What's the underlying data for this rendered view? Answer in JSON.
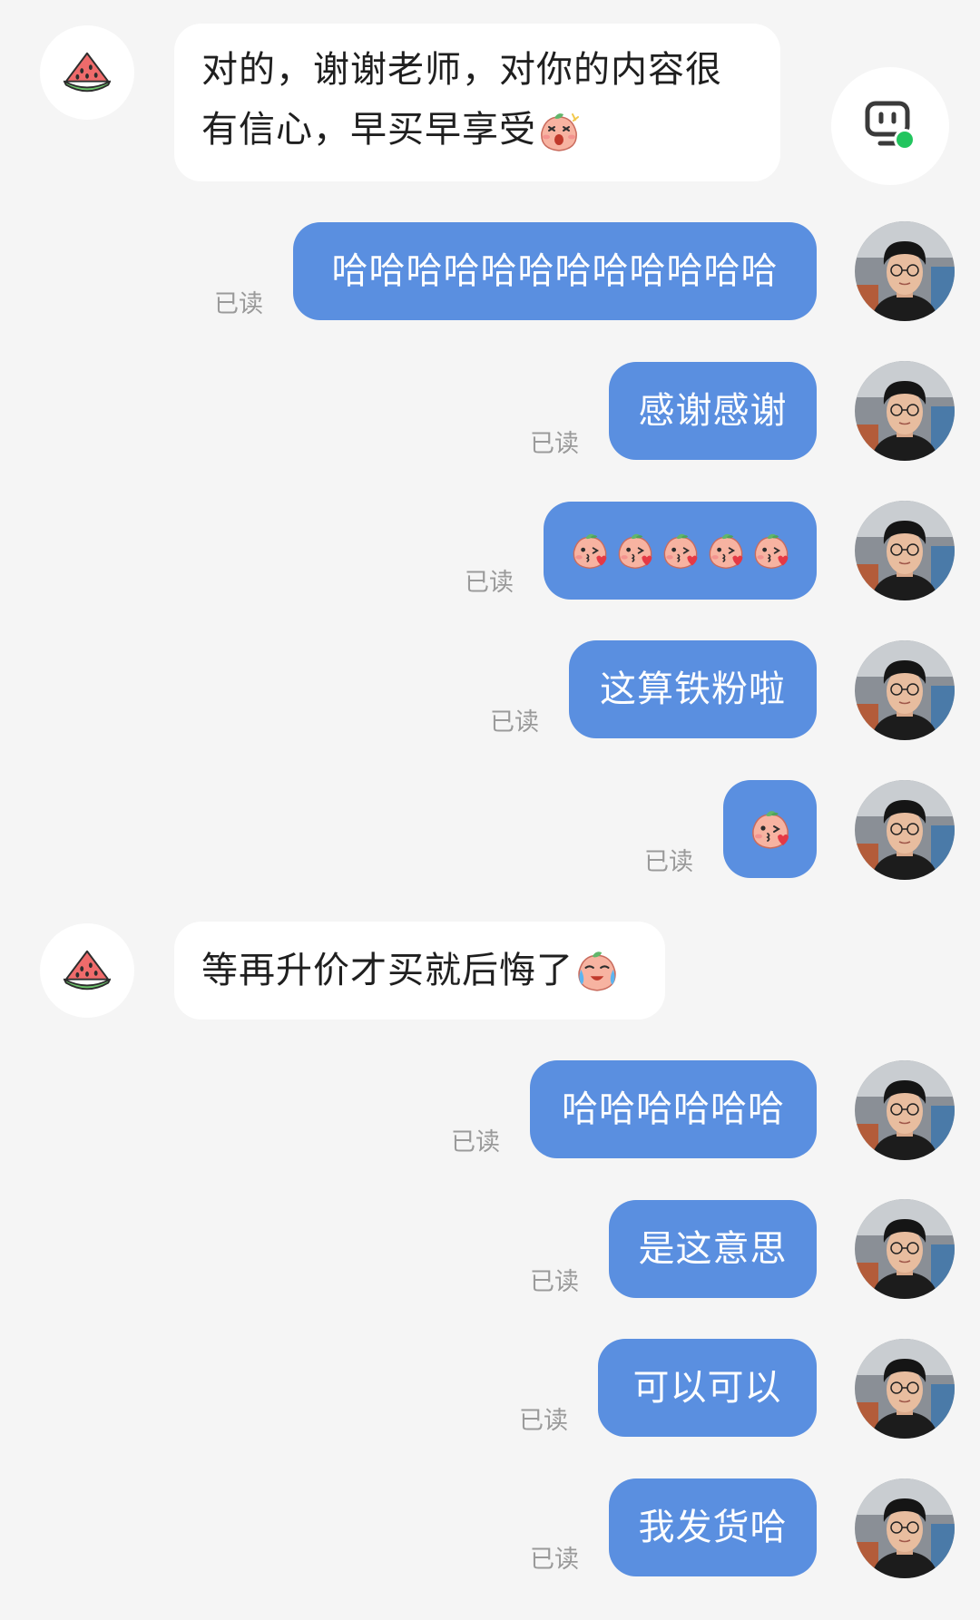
{
  "chat": {
    "read_label": "已读",
    "messages": [
      {
        "side": "in",
        "lines": [
          "对的，谢谢老师，对你的内容很",
          "有信心，早买早享受"
        ],
        "trailing_emoji": "peach-shock-emoji"
      },
      {
        "side": "out",
        "text": "哈哈哈哈哈哈哈哈哈哈哈哈",
        "read": "已读"
      },
      {
        "side": "out",
        "text": "感谢感谢",
        "read": "已读"
      },
      {
        "side": "out",
        "emojis": [
          "peach-kiss-emoji",
          "peach-kiss-emoji",
          "peach-kiss-emoji",
          "peach-kiss-emoji",
          "peach-kiss-emoji"
        ],
        "read": "已读"
      },
      {
        "side": "out",
        "text": "这算铁粉啦",
        "read": "已读"
      },
      {
        "side": "out",
        "emojis": [
          "peach-kiss-emoji"
        ],
        "read": "已读"
      },
      {
        "side": "in",
        "text": "等再升价才买就后悔了",
        "trailing_emoji": "peach-cry-emoji"
      },
      {
        "side": "out",
        "text": "哈哈哈哈哈哈",
        "read": "已读"
      },
      {
        "side": "out",
        "text": "是这意思",
        "read": "已读"
      },
      {
        "side": "out",
        "text": "可以可以",
        "read": "已读"
      },
      {
        "side": "out",
        "text": "我发货哈",
        "read": "已读"
      }
    ]
  },
  "icons": {
    "incoming_avatar": "watermelon-icon",
    "outgoing_avatar": "user-photo-avatar",
    "floating_button": "robot-assistant-icon",
    "online_indicator": "online-dot"
  },
  "colors": {
    "background": "#f5f5f5",
    "incoming_bubble": "#ffffff",
    "outgoing_bubble": "#5a8fe0",
    "read_text": "#9a9a9a",
    "online_dot": "#22c55e"
  }
}
